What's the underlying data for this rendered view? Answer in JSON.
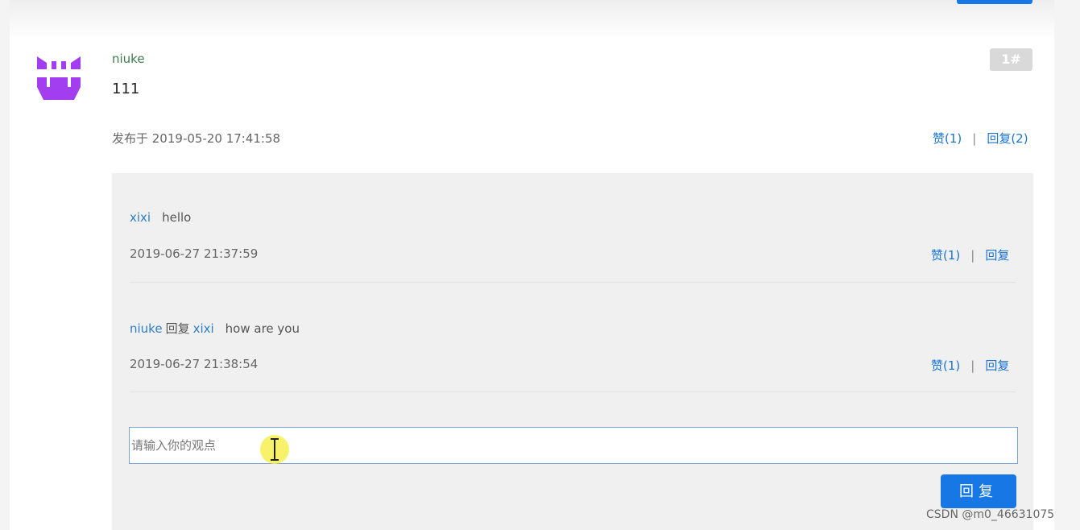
{
  "comment": {
    "username": "niuke",
    "floor_label": "1#",
    "content": "111",
    "posted_at": "发布于 2019-05-20 17:41:58",
    "like_label": "赞(1)",
    "reply_label": "回复(2)"
  },
  "replies": [
    {
      "user": "xixi",
      "text": "hello",
      "time": "2019-06-27 21:37:59",
      "like_label": "赞(1)",
      "reply_label": "回复"
    },
    {
      "user": "niuke",
      "verb": "回复",
      "target": "xixi",
      "text": "how are you",
      "time": "2019-06-27 21:38:54",
      "like_label": "赞(1)",
      "reply_label": "回复"
    }
  ],
  "action_separator": "|",
  "reply_form": {
    "placeholder": "请输入你的观点",
    "value": "",
    "submit_label": "回复"
  },
  "watermark": "CSDN @m0_46631075",
  "colors": {
    "accent": "#1677e5",
    "link": "#1a73d6",
    "avatar": "#a23ef0",
    "username": "#3f7a4c"
  },
  "icons": {
    "avatar": "pixel-identicon",
    "cursor": "text-ibeam-cursor"
  }
}
